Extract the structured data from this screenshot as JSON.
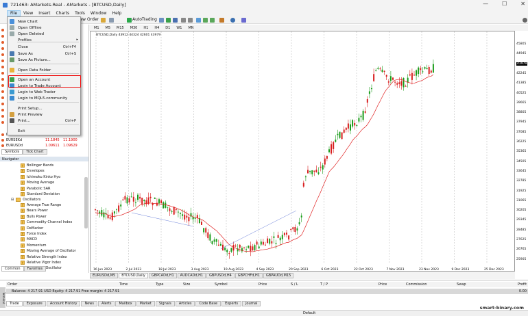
{
  "window": {
    "title": "721463: AMarkets-Real - AMarkets - [BTCUSD,Daily]",
    "min": "—",
    "max": "☐",
    "close": "✕"
  },
  "menubar": [
    "File",
    "View",
    "Insert",
    "Charts",
    "Tools",
    "Window",
    "Help"
  ],
  "toolbar": {
    "new_order": "New Order",
    "autotrading": "AutoTrading"
  },
  "timeframes": [
    "M1",
    "M5",
    "M15",
    "M30",
    "H1",
    "H4",
    "D1",
    "W1",
    "MN"
  ],
  "file_menu": {
    "items": [
      {
        "label": "New Chart",
        "shortcut": ""
      },
      {
        "label": "Open Offline",
        "shortcut": ""
      },
      {
        "label": "Open Deleted",
        "shortcut": ""
      },
      {
        "label": "Profiles",
        "shortcut": ""
      },
      {
        "label": "Close",
        "shortcut": "Ctrl+F4"
      },
      {
        "label": "Save As",
        "shortcut": "Ctrl+S"
      },
      {
        "label": "Save As Picture...",
        "shortcut": ""
      },
      {
        "label": "Open Data Folder",
        "shortcut": ""
      },
      {
        "label": "Open an Account",
        "shortcut": ""
      },
      {
        "label": "Login to Trade Account",
        "shortcut": ""
      },
      {
        "label": "Login to Web Trader",
        "shortcut": ""
      },
      {
        "label": "Login to MQL5.community",
        "shortcut": ""
      },
      {
        "label": "Print Setup...",
        "shortcut": ""
      },
      {
        "label": "Print Preview",
        "shortcut": ""
      },
      {
        "label": "Print...",
        "shortcut": "Ctrl+P"
      },
      {
        "label": "Exit",
        "shortcut": ""
      }
    ]
  },
  "market_watch": {
    "rows": [
      {
        "symbol": "EURUSDd",
        "bid": "1.11.75",
        "ask": "1.11.95"
      },
      {
        "symbol": "EURSEKd",
        "bid": "11.1845",
        "ask": "11.1900"
      },
      {
        "symbol": "EURUSDd",
        "bid": "1.09611",
        "ask": "1.09629"
      }
    ],
    "tabs": [
      "Symbols",
      "Tick Chart"
    ]
  },
  "navigator": {
    "header": "Navigator",
    "trend_items": [
      "Bollinger Bands",
      "Envelopes",
      "Ichimoku Kinko Hyo",
      "Moving Average",
      "Parabolic SAR",
      "Standard Deviation"
    ],
    "folder": "Oscillators",
    "osc_items": [
      "Average True Range",
      "Bears Power",
      "Bulls Power",
      "Commodity Channel Index",
      "DeMarker",
      "Force Index",
      "MACD",
      "Momentum",
      "Moving Average of Oscillator",
      "Relative Strength Index",
      "Relative Vigor Index",
      "Stochastic Oscillator"
    ],
    "tabs": [
      "Common",
      "Favorites"
    ]
  },
  "chart": {
    "header": "BTCUSD,Daily  43912 44324 42601 43979",
    "price_labels": [
      "45805",
      "44945",
      "43979",
      "42245",
      "41385",
      "40525",
      "39665",
      "38805",
      "37945",
      "37085",
      "36225",
      "35365",
      "34505",
      "33645",
      "32785",
      "31925",
      "31065",
      "30205",
      "29345",
      "28485",
      "27625",
      "26765",
      "25905"
    ],
    "current_price": "43979",
    "date_labels": [
      "16 Jun 2023",
      "2 Jul 2023",
      "18 Jul 2023",
      "3 Aug 2023",
      "19 Aug 2023",
      "4 Sep 2023",
      "20 Sep 2023",
      "6 Oct 2023",
      "22 Oct 2023",
      "7 Nov 2023",
      "23 Nov 2023",
      "9 Dec 2023",
      "25 Dec 2023"
    ],
    "tabs": [
      "EURUSDd,M5",
      "BTCUSD,Daily",
      "GBPCADd,H1",
      "AUDCADd,H1",
      "GBPUSDd,H4",
      "GBPCHFd,H1",
      "GBPAUDd,M15"
    ],
    "colors": {
      "bull": "#1a9c1a",
      "bear": "#d81e1e",
      "ma": "#e02020",
      "trendline": "#6a7fd8"
    }
  },
  "terminal": {
    "columns": [
      "Order",
      "Time",
      "Type",
      "Size",
      "Symbol",
      "Price",
      "S / L",
      "T / P",
      "Price",
      "Commission",
      "Swap",
      "Profit"
    ],
    "balance": "Balance: 4 217.91 USD   Equity: 4 217.91   Free margin: 4 217.91",
    "balance_profit": "0.00",
    "tabs": [
      "Trade",
      "Exposure",
      "Account History",
      "News",
      "Alerts",
      "Mailbox",
      "Market",
      "Signals",
      "Articles",
      "Code Base",
      "Experts",
      "Journal"
    ],
    "side_label": "Terminal"
  },
  "status": {
    "profile": "Default"
  },
  "watermark": "smart-binary.com"
}
